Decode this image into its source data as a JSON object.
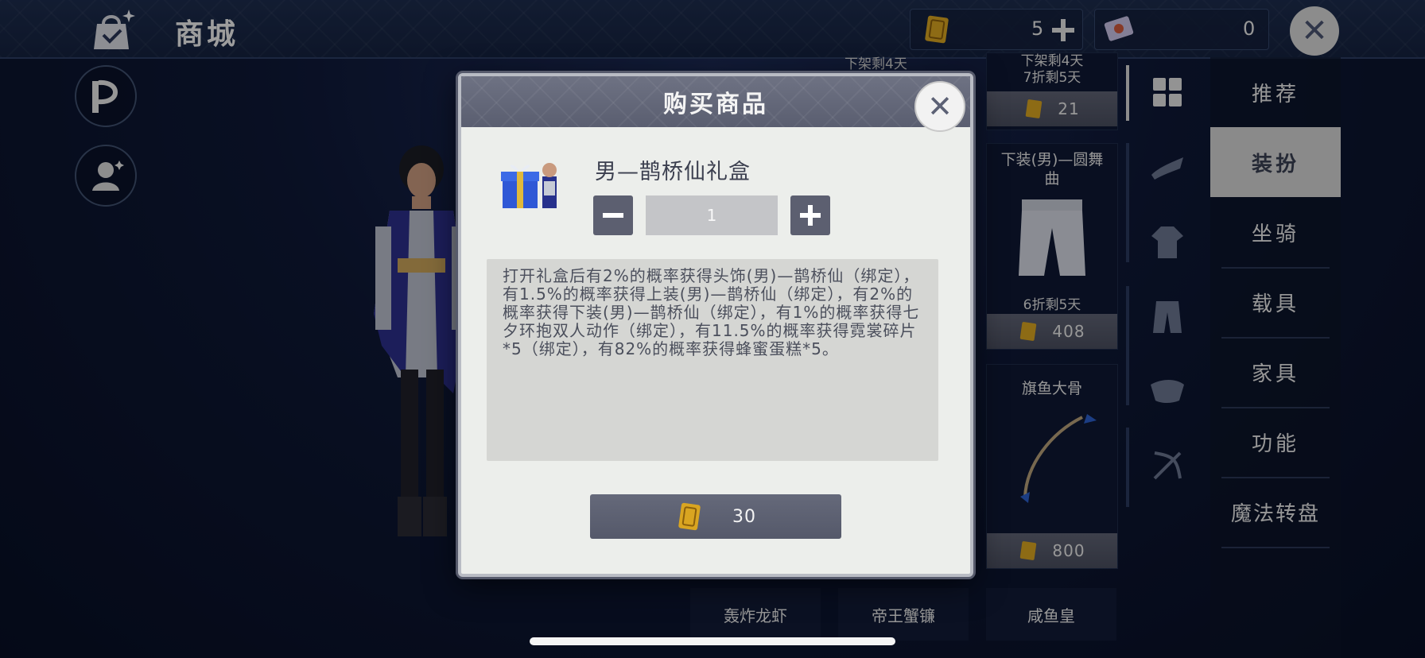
{
  "header": {
    "title": "商城",
    "currencies": [
      {
        "icon": "gold-coin-icon",
        "value": "5"
      },
      {
        "icon": "ticket-icon",
        "value": "0"
      }
    ]
  },
  "shop_cards": {
    "top_left_partial_sub": "下架剩4天",
    "card1": {
      "sub_top": "下架剩4天",
      "sub": "7折剩5天",
      "price": "21"
    },
    "card2": {
      "title": "下装(男)—圆舞曲",
      "sub": "6折剩5天",
      "price": "408"
    },
    "card3": {
      "title": "旗鱼大骨",
      "price": "800"
    },
    "bottom": [
      "轰炸龙虾",
      "帝王蟹镰",
      "咸鱼皇"
    ]
  },
  "menu": {
    "items": [
      "推荐",
      "装扮",
      "坐骑",
      "载具",
      "家具",
      "功能",
      "魔法转盘"
    ],
    "active_index": 1
  },
  "dialog": {
    "title": "购买商品",
    "item_name": "男—鹊桥仙礼盒",
    "quantity": "1",
    "description": "打开礼盒后有2%的概率获得头饰(男)—鹊桥仙（绑定），有1.5%的概率获得上装(男)—鹊桥仙（绑定），有2%的概率获得下装(男)—鹊桥仙（绑定），有1%的概率获得七夕环抱双人动作（绑定），有11.5%的概率获得霓裳碎片*5（绑定），有82%的概率获得蜂蜜蛋糕*5。",
    "price": "30"
  },
  "colors": {
    "background": "#0e1836",
    "dialog_bg": "#eceeeb",
    "button_dark": "#5c5f70",
    "gold": "#d9a521",
    "active_menu": "#d4d4d4"
  }
}
